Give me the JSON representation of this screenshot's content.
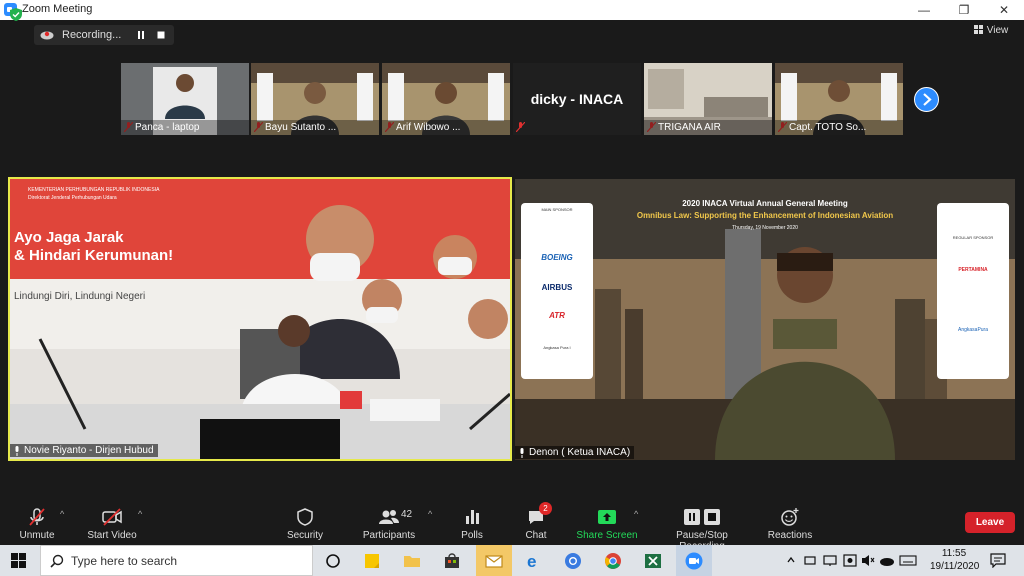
{
  "window": {
    "title": "Zoom Meeting"
  },
  "topbar": {
    "recording_label": "Recording...",
    "view_label": "View"
  },
  "strip": {
    "participants": [
      {
        "name": "Panca - laptop"
      },
      {
        "name": "Bayu Sutanto ..."
      },
      {
        "name": "Arif Wibowo ..."
      },
      {
        "name": "dicky - INACA"
      },
      {
        "name": "TRIGANA AIR"
      },
      {
        "name": "Capt. TOTO So..."
      }
    ]
  },
  "main": {
    "left": {
      "name": "Novie Riyanto - Dirjen Hubud",
      "banner_line1": "Ayo Jaga Jarak",
      "banner_line2": "& Hindari Kerumunan!",
      "banner_sub": "Lindungi Diri, Lindungi Negeri",
      "banner_header": "KEMENTERIAN PERHUBUNGAN REPUBLIK INDONESIA",
      "banner_header2": "Direktorat Jenderal Perhubungan Udara"
    },
    "right": {
      "name": "Denon ( Ketua INACA)",
      "event_title": "2020 INACA Virtual Annual General Meeting",
      "event_subtitle": "Omnibus Law: Supporting the Enhancement of Indonesian Aviation",
      "event_date": "Thursday, 19 November 2020",
      "sponsor_header": "MAIN SPONSOR",
      "sponsors": [
        "BOEING",
        "AIRBUS",
        "ATR",
        "Angkasa Pura I"
      ],
      "sponsor_header_right": "REGULAR SPONSOR",
      "sponsors_right": [
        "PERTAMINA",
        "AngkasaPura"
      ]
    }
  },
  "toolbar": {
    "unmute": "Unmute",
    "start_video": "Start Video",
    "security": "Security",
    "participants": "Participants",
    "participants_count": "42",
    "polls": "Polls",
    "chat": "Chat",
    "chat_badge": "2",
    "share_screen": "Share Screen",
    "pause_stop": "Pause/Stop Recording",
    "reactions": "Reactions",
    "leave": "Leave"
  },
  "taskbar": {
    "search_placeholder": "Type here to search",
    "time": "11:55",
    "date": "19/11/2020"
  },
  "colors": {
    "accent": "#2d8cff",
    "leave": "#d5222a",
    "share": "#23d959",
    "active_border": "#e6e94a"
  }
}
